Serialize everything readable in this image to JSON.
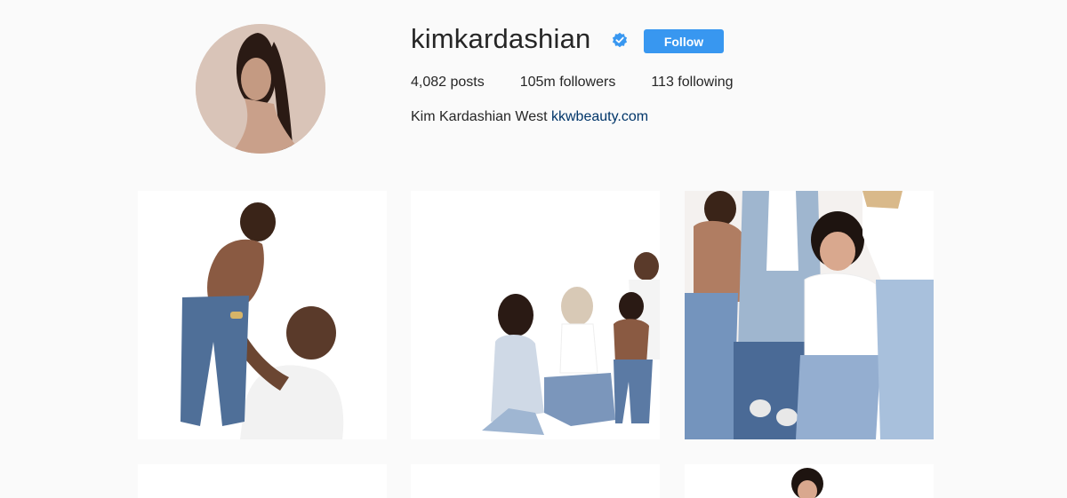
{
  "profile": {
    "username": "kimkardashian",
    "verified_icon": "verified-badge-icon",
    "follow_label": "Follow",
    "stats": {
      "posts": "4,082 posts",
      "followers": "105m followers",
      "following": "113 following"
    },
    "bio": {
      "name": "Kim Kardashian West",
      "link": "kkwbeauty.com"
    }
  },
  "colors": {
    "background": "#fafafa",
    "follow_button": "#3897f0",
    "verified_badge": "#3897f0",
    "link": "#003569"
  }
}
